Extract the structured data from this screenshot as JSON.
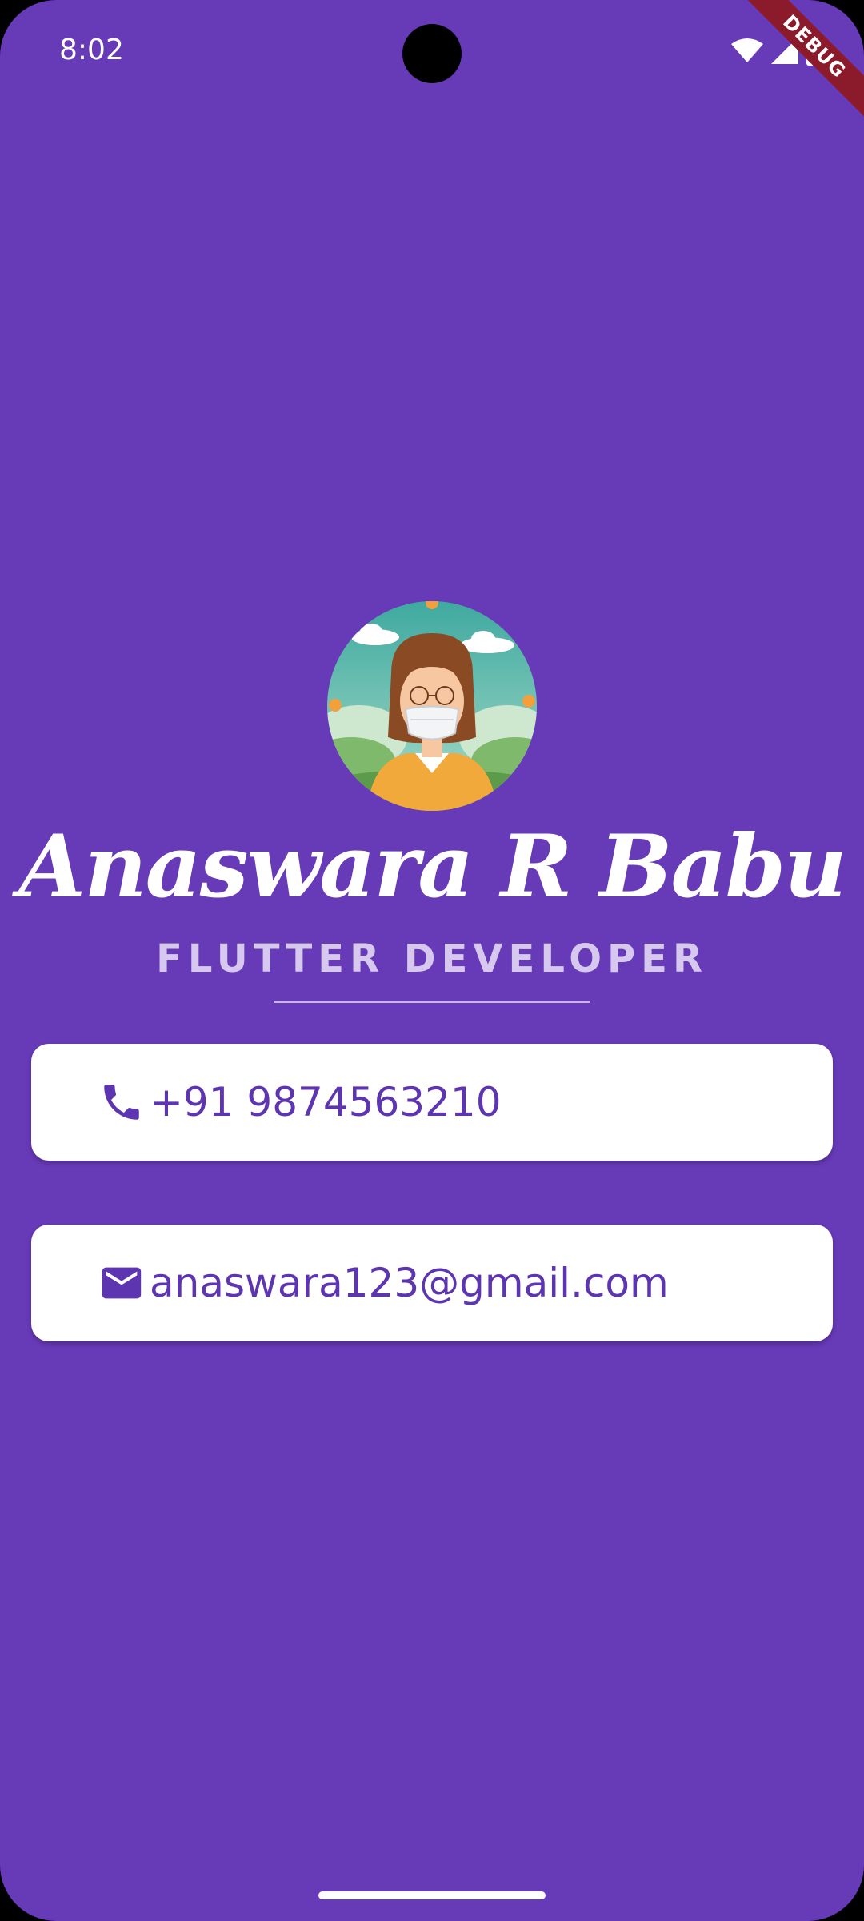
{
  "status_bar": {
    "time": "8:02",
    "icons": [
      "wifi-icon",
      "signal-icon",
      "battery-icon"
    ]
  },
  "debug_banner": "DEBUG",
  "profile": {
    "name": "Anaswara R Babu",
    "role": "FLUTTER DEVELOPER",
    "avatar": "avatar-illustration"
  },
  "contacts": {
    "phone": {
      "icon": "phone-icon",
      "value": "+91 9874563210"
    },
    "email": {
      "icon": "mail-icon",
      "value": "anaswara123@gmail.com"
    }
  },
  "colors": {
    "background": "#673AB7",
    "card": "#FFFFFF",
    "accent": "#5E35B1",
    "role_text": "#D6C8EE"
  }
}
